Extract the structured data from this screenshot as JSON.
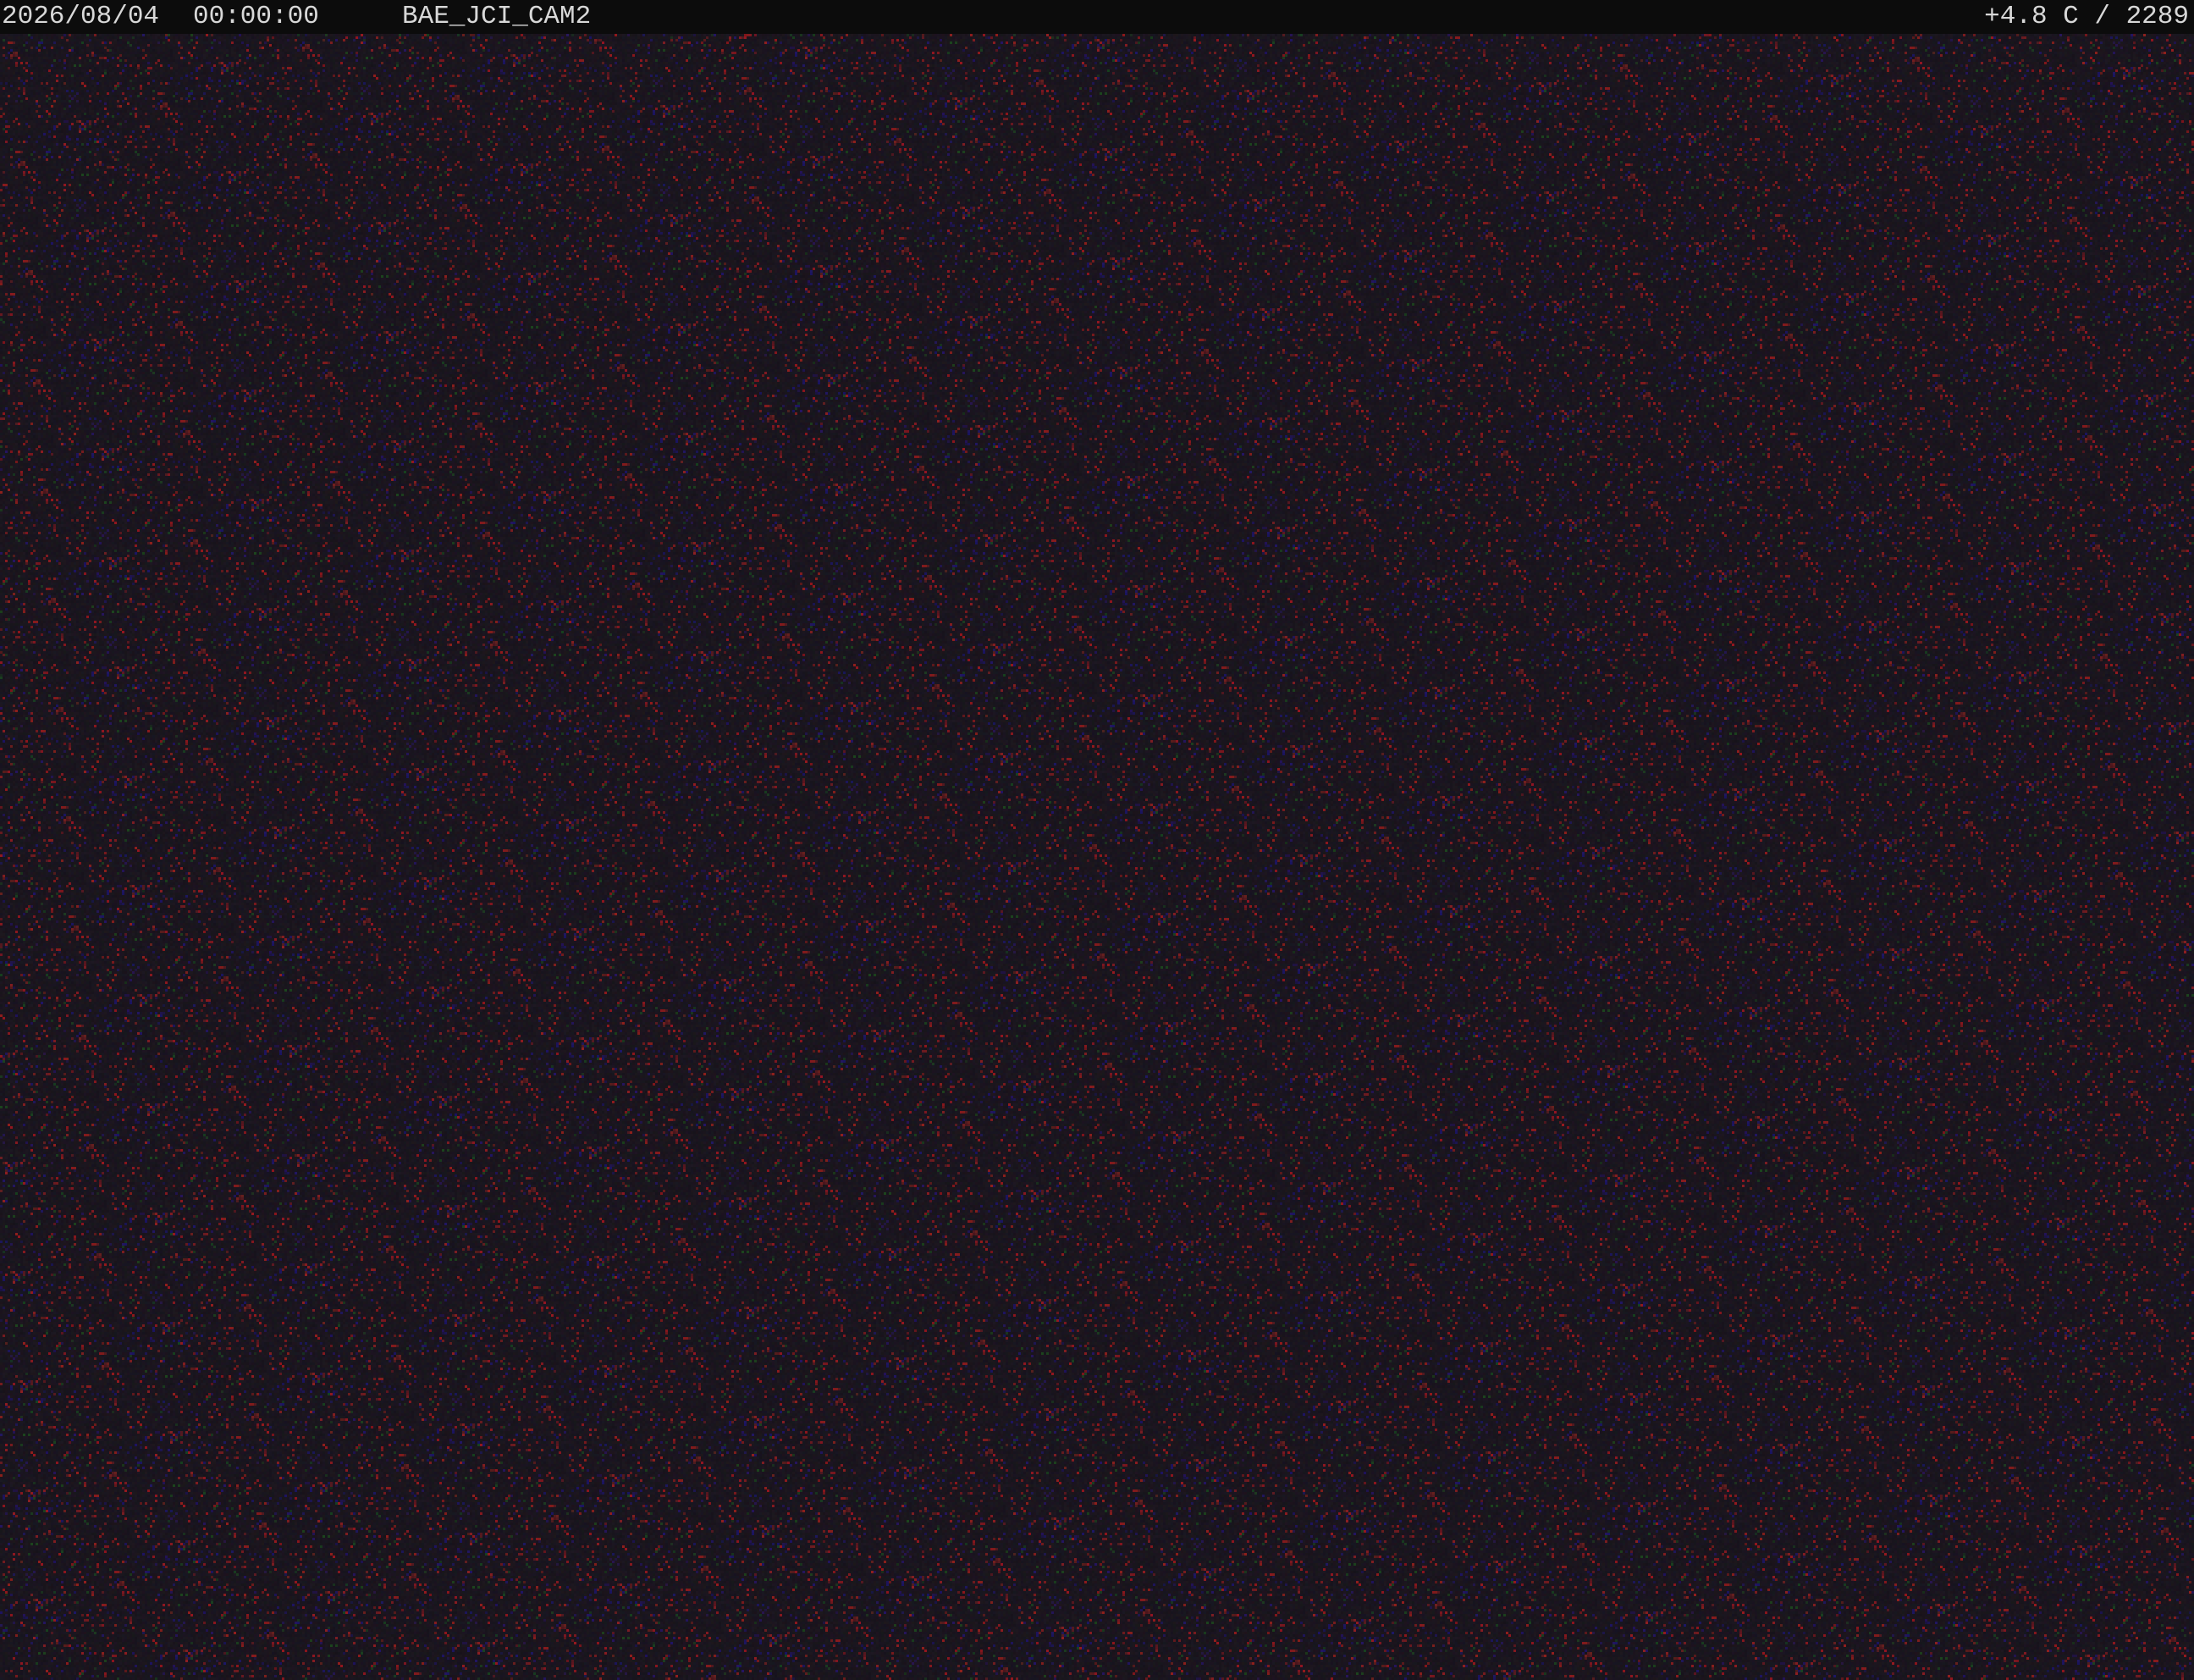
{
  "overlay": {
    "date": "2026/08/04",
    "time": "00:00:00",
    "camera_name": "BAE_JCI_CAM2",
    "temperature_info": "+4.8 C / 2289"
  },
  "colors": {
    "overlay_background": "#0c0c0c",
    "overlay_text": "#d8d8d8",
    "scene_background": "#17131b",
    "noise_red": "#b02a2a",
    "noise_blue": "#3a3080"
  }
}
